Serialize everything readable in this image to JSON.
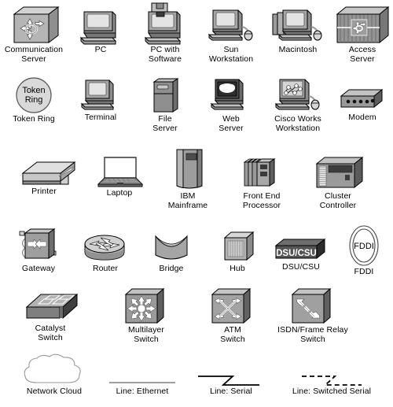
{
  "document": {
    "kind": "network-icon-legend",
    "background_color": "#ffffff",
    "text_color": "#000000",
    "palette": {
      "light_gray": "#d8d8d8",
      "mid_gray": "#a8a8a8",
      "dark_gray": "#6e6e6e",
      "darker_gray": "#4a4a4a",
      "near_black": "#2b2b2b",
      "screen_gray": "#e4e4e4",
      "outline": "#000000"
    }
  },
  "rows": [
    {
      "name": "row-1",
      "items": [
        {
          "id": "communication-server",
          "label": "Communication\nServer",
          "icon": "communication-server-icon"
        },
        {
          "id": "pc",
          "label": "PC",
          "icon": "pc-icon"
        },
        {
          "id": "pc-with-software",
          "label": "PC with\nSoftware",
          "icon": "pc-with-software-icon"
        },
        {
          "id": "sun-workstation",
          "label": "Sun\nWorkstation",
          "icon": "sun-workstation-icon"
        },
        {
          "id": "macintosh",
          "label": "Macintosh",
          "icon": "macintosh-icon"
        },
        {
          "id": "access-server",
          "label": "Access\nServer",
          "icon": "access-server-icon"
        }
      ]
    },
    {
      "name": "row-2",
      "items": [
        {
          "id": "token-ring",
          "label": "Token Ring",
          "icon": "token-ring-icon",
          "inner_text": "Token\nRing"
        },
        {
          "id": "terminal",
          "label": "Terminal",
          "icon": "terminal-icon"
        },
        {
          "id": "file-server",
          "label": "File\nServer",
          "icon": "file-server-icon"
        },
        {
          "id": "web-server",
          "label": "Web\nServer",
          "icon": "web-server-icon"
        },
        {
          "id": "cisco-works-workstation",
          "label": "Cisco Works\nWorkstation",
          "icon": "cisco-works-workstation-icon"
        },
        {
          "id": "modem",
          "label": "Modem",
          "icon": "modem-icon"
        }
      ]
    },
    {
      "name": "row-3",
      "items": [
        {
          "id": "printer",
          "label": "Printer",
          "icon": "printer-icon"
        },
        {
          "id": "laptop",
          "label": "Laptop",
          "icon": "laptop-icon"
        },
        {
          "id": "ibm-mainframe",
          "label": "IBM\nMainframe",
          "icon": "ibm-mainframe-icon"
        },
        {
          "id": "front-end-processor",
          "label": "Front End\nProcessor",
          "icon": "front-end-processor-icon"
        },
        {
          "id": "cluster-controller",
          "label": "Cluster\nController",
          "icon": "cluster-controller-icon"
        }
      ]
    },
    {
      "name": "row-4",
      "items": [
        {
          "id": "gateway",
          "label": "Gateway",
          "icon": "gateway-icon"
        },
        {
          "id": "router",
          "label": "Router",
          "icon": "router-icon"
        },
        {
          "id": "bridge",
          "label": "Bridge",
          "icon": "bridge-icon"
        },
        {
          "id": "hub",
          "label": "Hub",
          "icon": "hub-icon"
        },
        {
          "id": "dsu-csu",
          "label": "DSU/CSU",
          "icon": "dsu-csu-icon",
          "inner_text": "DSU/CSU"
        },
        {
          "id": "fddi",
          "label": "FDDI",
          "icon": "fddi-icon",
          "inner_text": "FDDI"
        }
      ]
    },
    {
      "name": "row-5",
      "items": [
        {
          "id": "catalyst-switch",
          "label": "Catalyst\nSwitch",
          "icon": "catalyst-switch-icon"
        },
        {
          "id": "multilayer-switch",
          "label": "Multilayer\nSwitch",
          "icon": "multilayer-switch-icon"
        },
        {
          "id": "atm-switch",
          "label": "ATM\nSwitch",
          "icon": "atm-switch-icon"
        },
        {
          "id": "isdn-frame-relay-switch",
          "label": "ISDN/Frame Relay\nSwitch",
          "icon": "isdn-frame-relay-switch-icon"
        }
      ]
    },
    {
      "name": "row-6",
      "items": [
        {
          "id": "network-cloud",
          "label": "Network Cloud",
          "icon": "network-cloud-icon"
        },
        {
          "id": "line-ethernet",
          "label": "Line: Ethernet",
          "icon": "line-ethernet-icon"
        },
        {
          "id": "line-serial",
          "label": "Line: Serial",
          "icon": "line-serial-icon"
        },
        {
          "id": "line-switched-serial",
          "label": "Line: Switched Serial",
          "icon": "line-switched-serial-icon"
        }
      ]
    }
  ]
}
